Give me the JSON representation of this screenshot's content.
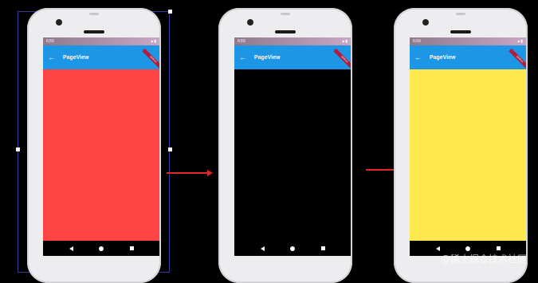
{
  "phones": [
    {
      "status_time": "6:59",
      "app_title": "PageView",
      "page_color": "#ff4444",
      "debug_label": "DEBUG"
    },
    {
      "status_time": "6:59",
      "app_title": "PageView",
      "page_color": "#000000",
      "debug_label": "DEBUG"
    },
    {
      "status_time": "6:59",
      "app_title": "PageView",
      "page_color": "#ffe84d",
      "debug_label": "DEBUG"
    }
  ],
  "colors": {
    "appbar": "#1e96e6",
    "arrow": "#e0282a"
  },
  "icons": {
    "back": "arrow-left-icon",
    "status": "signal-battery-icon"
  },
  "watermark": "@稀土掘金技术社区"
}
